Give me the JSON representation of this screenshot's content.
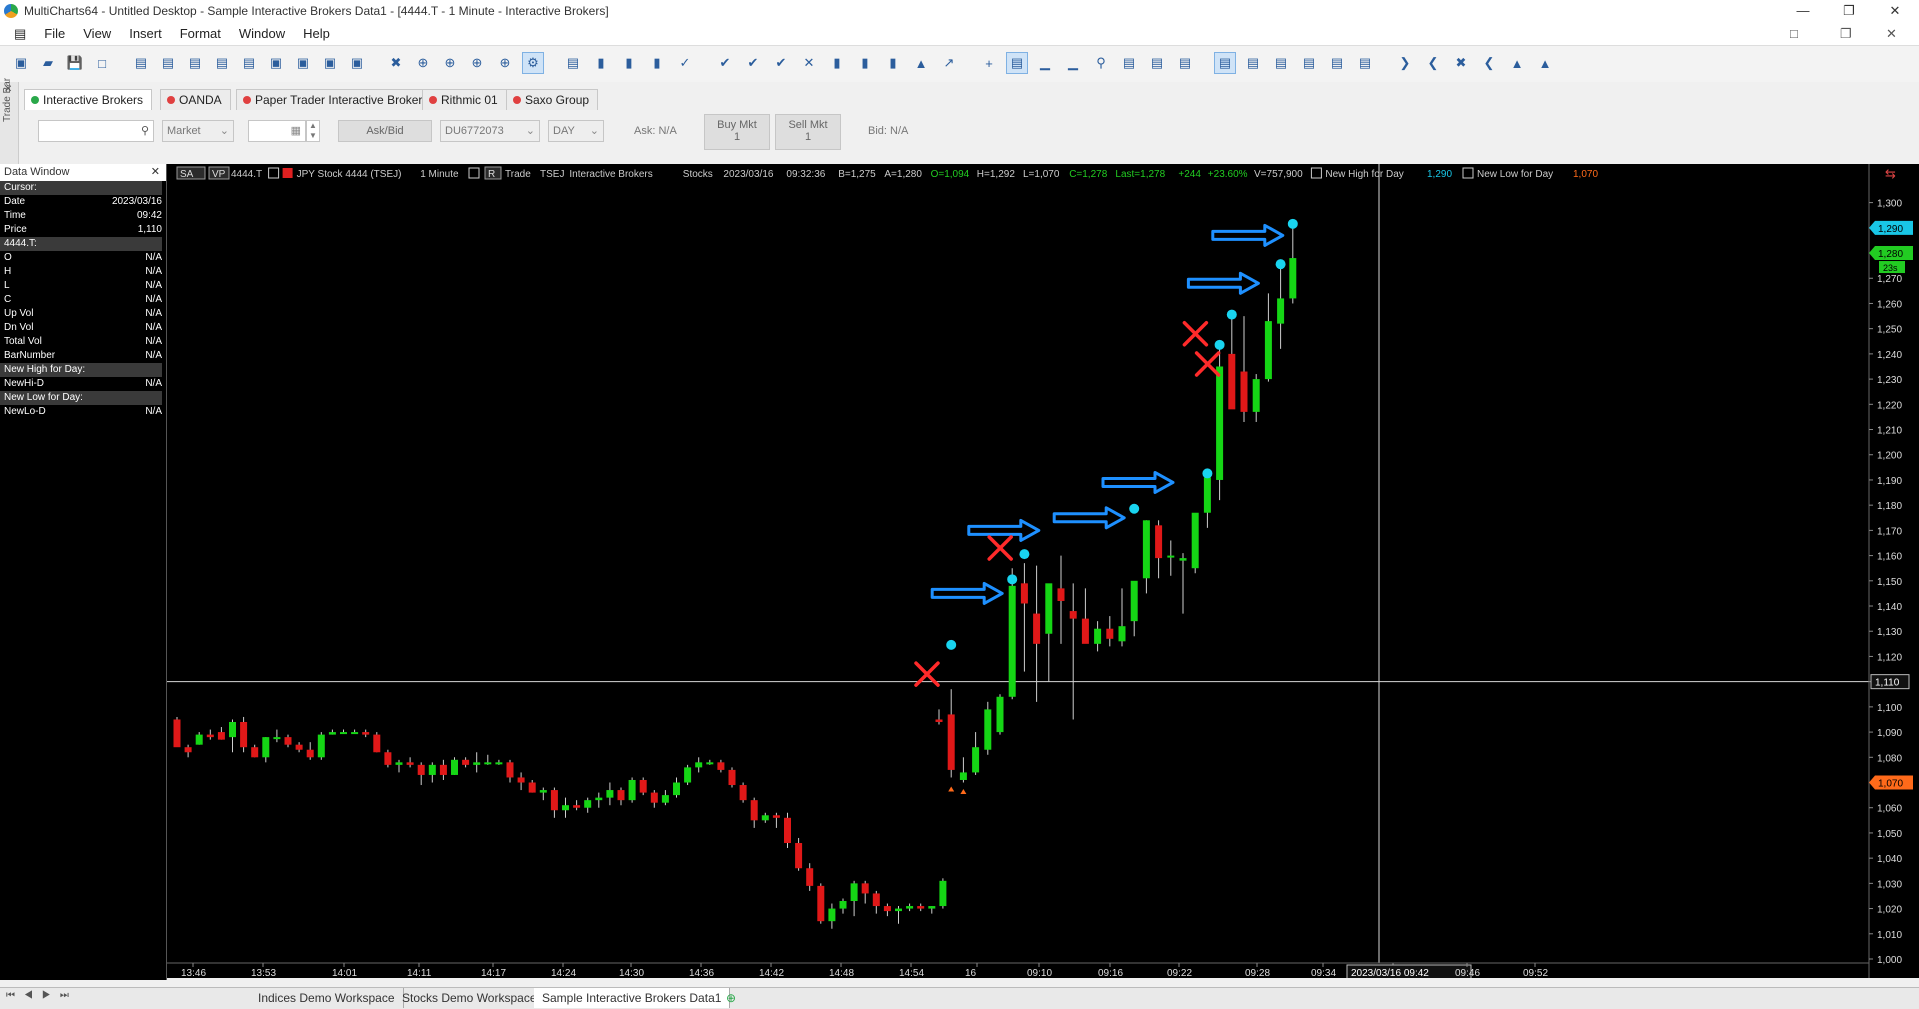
{
  "window": {
    "title": "MultiCharts64 - Untitled Desktop - Sample Interactive Brokers Data1 - [4444.T - 1 Minute - Interactive Brokers]"
  },
  "menu": [
    "File",
    "View",
    "Insert",
    "Format",
    "Window",
    "Help"
  ],
  "tradebar": {
    "side_label": "Trade Bar",
    "brokers": [
      {
        "label": "Interactive Brokers",
        "color": "#2aa84a",
        "active": true
      },
      {
        "label": "OANDA",
        "color": "#e04040",
        "active": false
      },
      {
        "label": "Paper Trader Interactive Brokers",
        "color": "#e04040",
        "active": false
      },
      {
        "label": "Rithmic 01",
        "color": "#e04040",
        "active": false
      },
      {
        "label": "Saxo Group",
        "color": "#e04040",
        "active": false
      }
    ],
    "order_type": "Market",
    "price_mode": "Ask/Bid",
    "account": "DU6772073",
    "tif": "DAY",
    "ask": "Ask: N/A",
    "bid": "Bid: N/A",
    "buy_label": "Buy Mkt",
    "buy_qty": "1",
    "sell_label": "Sell Mkt",
    "sell_qty": "1"
  },
  "datawindow": {
    "title": "Data Window",
    "rows": [
      {
        "k": "Cursor:",
        "v": "",
        "sec": true
      },
      {
        "k": "Date",
        "v": "2023/03/16",
        "sec": false
      },
      {
        "k": "Time",
        "v": "09:42",
        "sec": false
      },
      {
        "k": "Price",
        "v": "1,110",
        "sec": false
      },
      {
        "k": "4444.T:",
        "v": "",
        "sec": true
      },
      {
        "k": "O",
        "v": "N/A",
        "sec": false
      },
      {
        "k": "H",
        "v": "N/A",
        "sec": false
      },
      {
        "k": "L",
        "v": "N/A",
        "sec": false
      },
      {
        "k": "C",
        "v": "N/A",
        "sec": false
      },
      {
        "k": "Up Vol",
        "v": "N/A",
        "sec": false
      },
      {
        "k": "Dn Vol",
        "v": "N/A",
        "sec": false
      },
      {
        "k": "Total Vol",
        "v": "N/A",
        "sec": false
      },
      {
        "k": "BarNumber",
        "v": "N/A",
        "sec": false
      },
      {
        "k": "New High for Day:",
        "v": "",
        "sec": true
      },
      {
        "k": "NewHi-D",
        "v": "N/A",
        "sec": false
      },
      {
        "k": "New Low for Day:",
        "v": "",
        "sec": true
      },
      {
        "k": "NewLo-D",
        "v": "N/A",
        "sec": false
      }
    ]
  },
  "chart_header": {
    "sa": "SA",
    "vp": "VP",
    "symbol": "4444.T",
    "desc": "JPY Stock 4444 (TSEJ)",
    "resolution": "1 Minute",
    "r": "R",
    "trade": "Trade",
    "exchange": "TSEJ",
    "broker": "Interactive Brokers",
    "category": "Stocks",
    "date": "2023/03/16",
    "time": "09:32:36",
    "b": "B=1,275",
    "a": "A=1,280",
    "o": "O=1,094",
    "h": "H=1,292",
    "l": "L=1,070",
    "c": "C=1,278",
    "last": "Last=1,278",
    "chg": "+244",
    "chgpct": "+23.60%",
    "vol": "V=757,900",
    "nh_label": "New High for Day",
    "nh_val": "1,290",
    "nl_label": "New Low for Day",
    "nl_val": "1,070"
  },
  "chart_data": {
    "type": "candlestick",
    "symbol": "4444.T",
    "ylim": [
      1000,
      1305
    ],
    "yticks": [
      1000,
      1010,
      1020,
      1030,
      1040,
      1050,
      1060,
      1070,
      1080,
      1090,
      1100,
      1110,
      1120,
      1130,
      1140,
      1150,
      1160,
      1170,
      1180,
      1190,
      1200,
      1210,
      1220,
      1230,
      1240,
      1250,
      1260,
      1270,
      1280,
      1290,
      1300
    ],
    "xlabels": [
      "13:46",
      "13:53",
      "14:01",
      "14:11",
      "14:17",
      "14:24",
      "14:30",
      "14:36",
      "14:42",
      "14:48",
      "14:54",
      "16",
      "09:10",
      "09:16",
      "09:22",
      "09:28",
      "09:34",
      "2023/03/16 09:42",
      "09:46",
      "09:52"
    ],
    "crosshair_price": 1110,
    "crosshair_price_label": "1,110",
    "crosshair_time_label": "2023/03/16 09:42",
    "price_markers": [
      {
        "value": 1290,
        "label": "1,290",
        "color": "#19c6e6"
      },
      {
        "value": 1280,
        "label": "1,280",
        "color": "#22cc22"
      },
      {
        "value": 1070,
        "label": "1,070",
        "color": "#ff6a1a"
      }
    ],
    "timer_label": "23s",
    "candles_day1": [
      [
        1095,
        1096,
        1085,
        1084
      ],
      [
        1084,
        1085,
        1080,
        1082
      ],
      [
        1085,
        1090,
        1085,
        1089
      ],
      [
        1089,
        1091,
        1087,
        1088
      ],
      [
        1090,
        1092,
        1087,
        1087
      ],
      [
        1088,
        1095,
        1082,
        1094
      ],
      [
        1094,
        1096,
        1082,
        1084
      ],
      [
        1084,
        1085,
        1080,
        1080
      ],
      [
        1080,
        1088,
        1078,
        1088
      ],
      [
        1088,
        1091,
        1086,
        1088
      ],
      [
        1088,
        1089,
        1084,
        1085
      ],
      [
        1085,
        1086,
        1082,
        1083
      ],
      [
        1083,
        1086,
        1079,
        1080
      ],
      [
        1080,
        1090,
        1079,
        1089
      ],
      [
        1089,
        1091,
        1089,
        1090
      ],
      [
        1090,
        1091,
        1090,
        1090
      ],
      [
        1090,
        1091,
        1090,
        1090
      ],
      [
        1090,
        1091,
        1088,
        1089
      ],
      [
        1089,
        1090,
        1082,
        1082
      ],
      [
        1082,
        1083,
        1076,
        1077
      ],
      [
        1077,
        1079,
        1074,
        1078
      ],
      [
        1078,
        1080,
        1076,
        1077
      ],
      [
        1077,
        1078,
        1069,
        1073
      ],
      [
        1073,
        1078,
        1070,
        1077
      ],
      [
        1077,
        1079,
        1071,
        1073
      ],
      [
        1073,
        1080,
        1073,
        1079
      ],
      [
        1079,
        1080,
        1076,
        1077
      ],
      [
        1077,
        1082,
        1074,
        1078
      ],
      [
        1078,
        1081,
        1077,
        1078
      ],
      [
        1078,
        1079,
        1077,
        1078
      ],
      [
        1078,
        1079,
        1070,
        1072
      ],
      [
        1072,
        1074,
        1067,
        1070
      ],
      [
        1070,
        1071,
        1066,
        1066
      ],
      [
        1066,
        1068,
        1063,
        1067
      ],
      [
        1067,
        1068,
        1056,
        1059
      ],
      [
        1059,
        1064,
        1056,
        1061
      ],
      [
        1061,
        1063,
        1059,
        1060
      ],
      [
        1060,
        1064,
        1058,
        1063
      ],
      [
        1063,
        1066,
        1060,
        1064
      ],
      [
        1064,
        1070,
        1061,
        1067
      ],
      [
        1067,
        1068,
        1061,
        1063
      ],
      [
        1063,
        1072,
        1062,
        1071
      ],
      [
        1071,
        1072,
        1065,
        1066
      ],
      [
        1066,
        1067,
        1060,
        1062
      ],
      [
        1062,
        1067,
        1061,
        1065
      ],
      [
        1065,
        1072,
        1064,
        1070
      ],
      [
        1070,
        1077,
        1069,
        1076
      ],
      [
        1076,
        1080,
        1074,
        1078
      ],
      [
        1078,
        1079,
        1077,
        1078
      ],
      [
        1078,
        1079,
        1074,
        1075
      ],
      [
        1075,
        1076,
        1068,
        1069
      ],
      [
        1069,
        1070,
        1062,
        1063
      ],
      [
        1063,
        1064,
        1052,
        1055
      ],
      [
        1055,
        1058,
        1054,
        1057
      ],
      [
        1057,
        1058,
        1052,
        1056
      ],
      [
        1056,
        1058,
        1044,
        1046
      ],
      [
        1046,
        1048,
        1035,
        1036
      ],
      [
        1036,
        1038,
        1027,
        1029
      ],
      [
        1029,
        1030,
        1014,
        1015
      ],
      [
        1015,
        1022,
        1012,
        1020
      ],
      [
        1020,
        1024,
        1018,
        1023
      ],
      [
        1023,
        1031,
        1017,
        1030
      ],
      [
        1030,
        1031,
        1022,
        1026
      ],
      [
        1026,
        1027,
        1018,
        1021
      ],
      [
        1021,
        1022,
        1017,
        1019
      ],
      [
        1019,
        1021,
        1014,
        1020
      ],
      [
        1020,
        1022,
        1019,
        1021
      ],
      [
        1021,
        1022,
        1019,
        1020
      ],
      [
        1020,
        1021,
        1018,
        1021
      ],
      [
        1021,
        1032,
        1020,
        1031
      ]
    ],
    "candles_day2": [
      [
        1095,
        1099,
        1093,
        1094
      ],
      [
        1097,
        1107,
        1072,
        1075
      ],
      [
        1071,
        1080,
        1070,
        1074
      ],
      [
        1074,
        1090,
        1073,
        1084
      ],
      [
        1083,
        1102,
        1081,
        1099
      ],
      [
        1090,
        1105,
        1089,
        1104
      ],
      [
        1104,
        1155,
        1103,
        1148
      ],
      [
        1149,
        1157,
        1114,
        1141
      ],
      [
        1137,
        1156,
        1102,
        1125
      ],
      [
        1129,
        1148,
        1110,
        1149
      ],
      [
        1147,
        1160,
        1125,
        1142
      ],
      [
        1138,
        1149,
        1095,
        1135
      ],
      [
        1135,
        1147,
        1127,
        1125
      ],
      [
        1125,
        1134,
        1122,
        1131
      ],
      [
        1131,
        1136,
        1124,
        1127
      ],
      [
        1126,
        1147,
        1124,
        1132
      ],
      [
        1134,
        1147,
        1128,
        1150
      ],
      [
        1151,
        1174,
        1145,
        1174
      ],
      [
        1172,
        1174,
        1151,
        1159
      ],
      [
        1160,
        1166,
        1152,
        1160
      ],
      [
        1158,
        1161,
        1137,
        1159
      ],
      [
        1155,
        1174,
        1153,
        1177
      ],
      [
        1177,
        1194,
        1171,
        1191
      ],
      [
        1190,
        1245,
        1182,
        1235
      ],
      [
        1240,
        1255,
        1224,
        1218
      ],
      [
        1233,
        1255,
        1213,
        1217
      ],
      [
        1217,
        1232,
        1213,
        1230
      ],
      [
        1230,
        1264,
        1229,
        1253
      ],
      [
        1252,
        1275,
        1242,
        1262
      ],
      [
        1262,
        1292,
        1260,
        1278
      ]
    ],
    "new_high_markers": [
      {
        "bar": 1,
        "value": 1123
      },
      {
        "bar": 6,
        "value": 1149
      },
      {
        "bar": 7,
        "value": 1159
      },
      {
        "bar": 16,
        "value": 1177
      },
      {
        "bar": 22,
        "value": 1191
      },
      {
        "bar": 23,
        "value": 1242
      },
      {
        "bar": 24,
        "value": 1254
      },
      {
        "bar": 28,
        "value": 1274
      },
      {
        "bar": 29,
        "value": 1290
      }
    ],
    "new_low_markers": [
      {
        "bar": 1,
        "value": 1070
      },
      {
        "bar": 2,
        "value": 1069
      }
    ],
    "annotations_arrows": [
      {
        "bar": 6,
        "value": 1145
      },
      {
        "bar": 9,
        "value": 1170
      },
      {
        "bar": 16,
        "value": 1175
      },
      {
        "bar": 20,
        "value": 1189
      },
      {
        "bar": 27,
        "value": 1268
      },
      {
        "bar": 29,
        "value": 1287
      }
    ],
    "annotations_crosses": [
      {
        "bar": 0,
        "value": 1113
      },
      {
        "bar": 6,
        "value": 1163
      },
      {
        "bar": 22,
        "value": 1248
      },
      {
        "bar": 23,
        "value": 1236
      }
    ]
  },
  "bottom_tabs": [
    {
      "label": "Indices Demo Workspace",
      "active": false
    },
    {
      "label": "Stocks Demo Workspace",
      "active": false
    },
    {
      "label": "Sample Interactive Brokers Data1",
      "active": true
    }
  ]
}
